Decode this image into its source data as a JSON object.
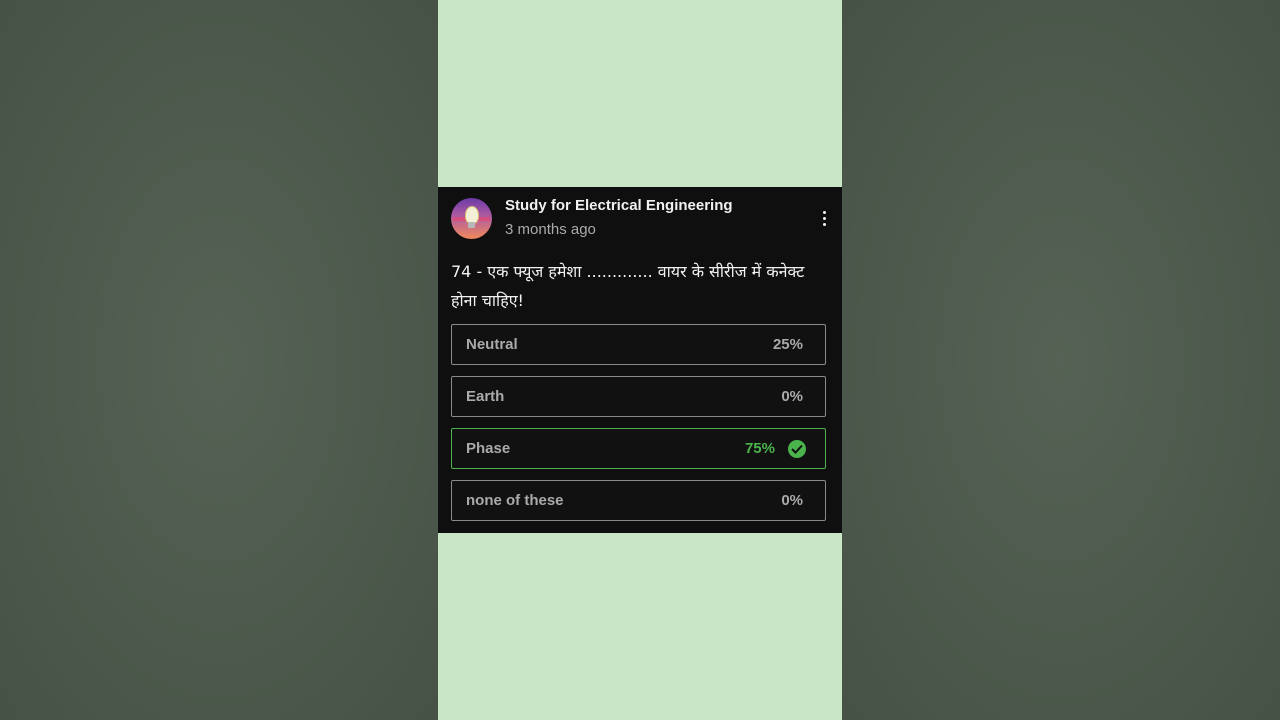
{
  "post": {
    "channel_name": "Study for Electrical Engineering",
    "timestamp": "3 months ago",
    "avatar_icon": "lightbulb-logo-icon",
    "menu_icon": "more-vert-icon"
  },
  "poll": {
    "question": "74 - एक फ्यूज हमेशा ............. वायर के सीरीज में कनेक्ट होना चाहिए!",
    "options": [
      {
        "label": "Neutral",
        "percent": "25%",
        "correct": false
      },
      {
        "label": "Earth",
        "percent": "0%",
        "correct": false
      },
      {
        "label": "Phase",
        "percent": "75%",
        "correct": true
      },
      {
        "label": "none of these",
        "percent": "0%",
        "correct": false
      }
    ]
  },
  "colors": {
    "card_bg": "#0f0f0f",
    "correct": "#4bb34b",
    "phone_bg": "#c9e7c6"
  }
}
